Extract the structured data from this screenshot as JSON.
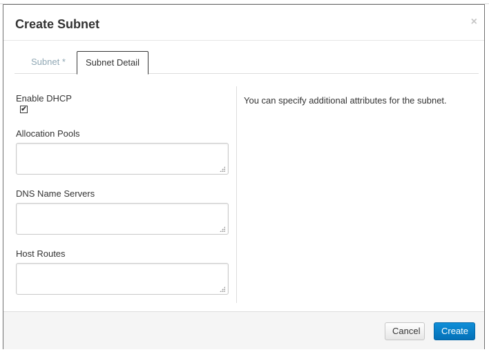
{
  "modal": {
    "title": "Create Subnet",
    "close_label": "×"
  },
  "tabs": [
    {
      "label": "Subnet *",
      "active": false
    },
    {
      "label": "Subnet Detail",
      "active": true
    }
  ],
  "form": {
    "enable_dhcp": {
      "label": "Enable DHCP",
      "checked": true,
      "check_mark": "✔"
    },
    "allocation_pools": {
      "label": "Allocation Pools",
      "value": ""
    },
    "dns_name_servers": {
      "label": "DNS Name Servers",
      "value": ""
    },
    "host_routes": {
      "label": "Host Routes",
      "value": ""
    }
  },
  "help": {
    "text": "You can specify additional attributes for the subnet."
  },
  "footer": {
    "cancel_label": "Cancel",
    "create_label": "Create"
  },
  "colors": {
    "primary": "#0470b7",
    "inactive_tab": "#8fa7b4"
  }
}
